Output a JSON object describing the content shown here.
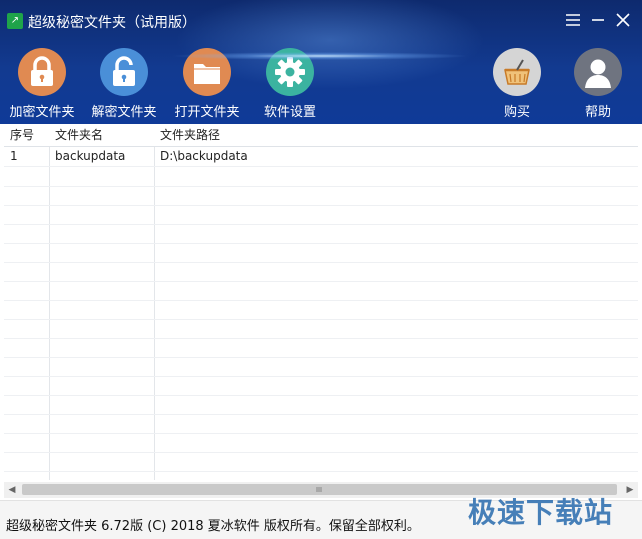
{
  "window": {
    "title": "超级秘密文件夹（试用版）",
    "app_icon_glyph": "↗"
  },
  "toolbar": {
    "items": [
      {
        "label": "加密文件夹",
        "icon": "lock-closed-icon",
        "color": "#e08a52"
      },
      {
        "label": "解密文件夹",
        "icon": "lock-open-icon",
        "color": "#4a8fd8"
      },
      {
        "label": "打开文件夹",
        "icon": "folder-icon",
        "color": "#e08a52"
      },
      {
        "label": "软件设置",
        "icon": "gear-icon",
        "color": "#3bb3a0"
      }
    ],
    "right_items": [
      {
        "label": "购买",
        "icon": "basket-icon",
        "color": "#d5d5d5"
      },
      {
        "label": "帮助",
        "icon": "user-icon",
        "color": "#6f7480"
      }
    ]
  },
  "table": {
    "headers": [
      "序号",
      "文件夹名",
      "文件夹路径"
    ],
    "rows": [
      {
        "no": "1",
        "name": "backupdata",
        "path": "D:\\backupdata"
      }
    ]
  },
  "status": {
    "text": "超级秘密文件夹 6.72版 (C) 2018 夏冰软件 版权所有。保留全部权利。"
  },
  "watermark": {
    "text": "极速下载站"
  }
}
